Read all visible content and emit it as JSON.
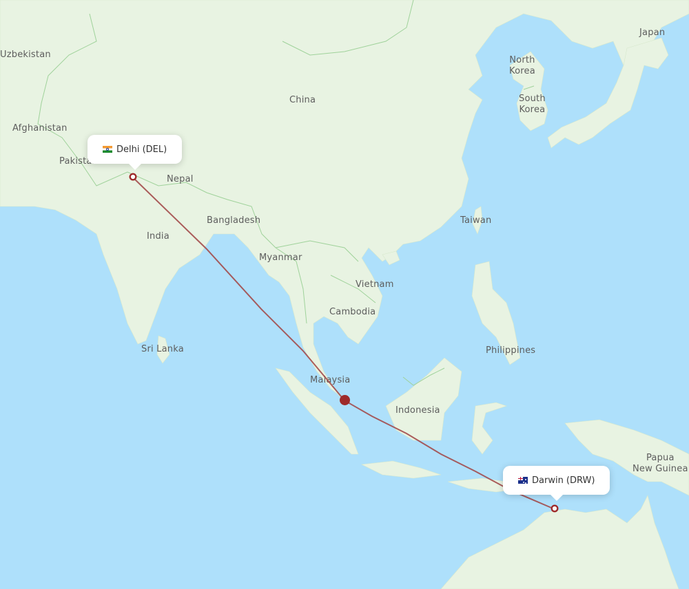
{
  "map": {
    "colors": {
      "water": "#aee0fb",
      "land": "#e8f3e2",
      "border": "#9fd29a",
      "route": "#a34b4b",
      "stopover": "#9e2a2a",
      "label": "#5d5d5d"
    },
    "country_labels": [
      {
        "name": "Uzbekistan"
      },
      {
        "name": "Afghanistan"
      },
      {
        "name": "Pakistan"
      },
      {
        "name": "Nepal"
      },
      {
        "name": "China"
      },
      {
        "name": "India"
      },
      {
        "name": "Bangladesh"
      },
      {
        "name": "Myanmar"
      },
      {
        "name": "Vietnam"
      },
      {
        "name": "Cambodia"
      },
      {
        "name": "Taiwan"
      },
      {
        "name": "North\nKorea"
      },
      {
        "name": "South\nKorea"
      },
      {
        "name": "Japan"
      },
      {
        "name": "Sri Lanka"
      },
      {
        "name": "Malaysia"
      },
      {
        "name": "Philippines"
      },
      {
        "name": "Indonesia"
      },
      {
        "name": "Papua\nNew Guinea"
      }
    ]
  },
  "route": {
    "origin": {
      "label": "Delhi (DEL)",
      "city": "Delhi",
      "code": "DEL",
      "flag": "india-flag"
    },
    "destination": {
      "label": "Darwin (DRW)",
      "city": "Darwin",
      "code": "DRW",
      "flag": "australia-flag"
    },
    "stopover": {
      "region": "Singapore area"
    }
  }
}
